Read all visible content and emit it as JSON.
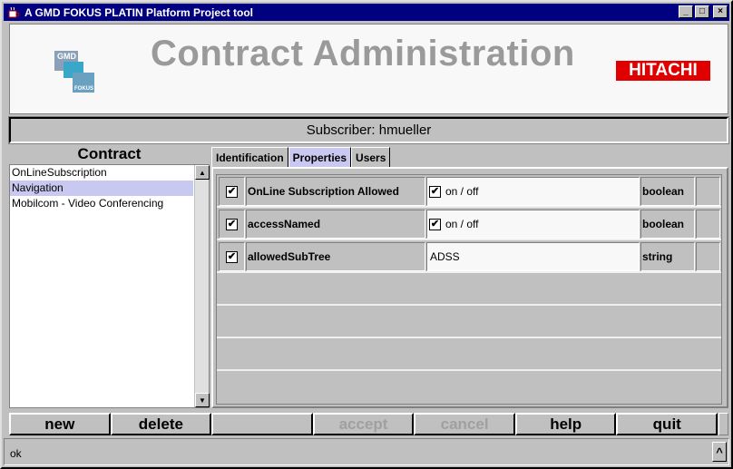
{
  "window": {
    "title": "A GMD FOKUS PLATIN Platform Project tool",
    "controls": {
      "minimize": "_",
      "maximize": "□",
      "close": "×"
    }
  },
  "header": {
    "title": "Contract Administration",
    "gmd_logo": {
      "top": "GMD",
      "bottom": "FOKUS"
    },
    "brand": "HITACHI"
  },
  "subscriber": {
    "text": "Subscriber: hmueller"
  },
  "contract": {
    "label": "Contract",
    "items": [
      "OnLineSubscription",
      "Navigation",
      "Mobilcom - Video Conferencing"
    ],
    "selected_index": 1
  },
  "tabs": [
    {
      "label": "Identification",
      "active": false
    },
    {
      "label": "Properties",
      "active": true
    },
    {
      "label": "Users",
      "active": false
    }
  ],
  "properties": [
    {
      "checked": true,
      "name": "OnLine Subscription Allowed",
      "value_checked": true,
      "value": "on / off",
      "type": "boolean"
    },
    {
      "checked": true,
      "name": "accessNamed",
      "value_checked": true,
      "value": "on / off",
      "type": "boolean"
    },
    {
      "checked": true,
      "name": "allowedSubTree",
      "value": "ADSS",
      "type": "string"
    }
  ],
  "buttons": {
    "new": "new",
    "delete": "delete",
    "accept": "accept",
    "cancel": "cancel",
    "help": "help",
    "quit": "quit"
  },
  "status": {
    "message": "ok",
    "caret": "^"
  },
  "colors": {
    "titlebar": "#000080",
    "selection": "#c8c8f0",
    "brand": "#e00000",
    "title_text": "#9a9a9a"
  }
}
